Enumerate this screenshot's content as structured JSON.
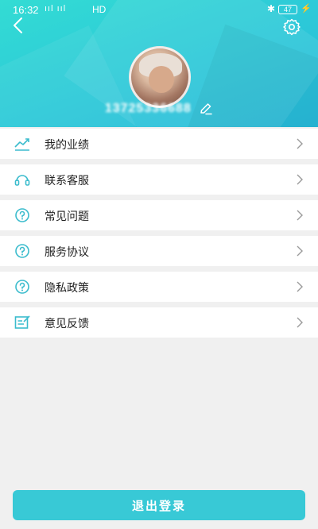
{
  "status_bar": {
    "time": "16:32",
    "signals": "ııl ııl",
    "network": "HD",
    "battery": "47"
  },
  "header": {
    "username": "13725336688"
  },
  "menu": [
    {
      "label": "我的业绩",
      "icon": "trend-chart-icon"
    },
    {
      "label": "联系客服",
      "icon": "headset-icon"
    },
    {
      "label": "常见问题",
      "icon": "question-circle-icon"
    },
    {
      "label": "服务协议",
      "icon": "question-circle-icon"
    },
    {
      "label": "隐私政策",
      "icon": "question-circle-icon"
    },
    {
      "label": "意见反馈",
      "icon": "feedback-edit-icon"
    }
  ],
  "logout_label": "退出登录",
  "colors": {
    "accent": "#38c9d6",
    "icon": "#3bbccd",
    "header_start": "#33dcd4",
    "header_end": "#27b9d9"
  }
}
